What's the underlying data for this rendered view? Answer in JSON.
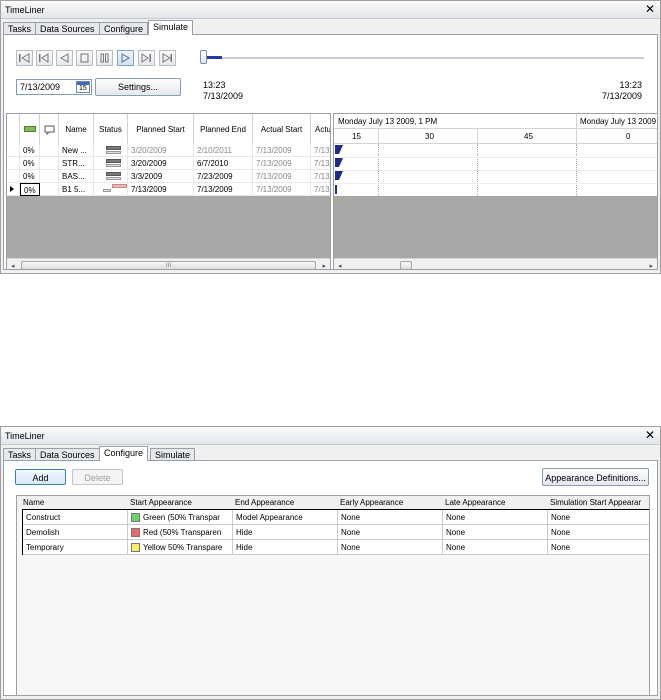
{
  "top": {
    "window_title": "TimeLiner",
    "tabs": [
      "Tasks",
      "Data Sources",
      "Configure",
      "Simulate"
    ],
    "date_input": "7/13/2009",
    "calendar_day": "15",
    "settings_label": "Settings...",
    "time_left": "13:23",
    "date_left": "7/13/2009",
    "time_right": "13:23",
    "date_right": "7/13/2009",
    "slider_position_fraction": 0.0,
    "columns": [
      "Name",
      "Status",
      "Planned Start",
      "Planned End",
      "Actual Start",
      "Actu"
    ],
    "rows": [
      {
        "pct": "0%",
        "name": "New ...",
        "ps": "3/20/2009",
        "pe": "2/10/2011",
        "as": "7/13/2009",
        "ae": "7/13/",
        "dim": true
      },
      {
        "pct": "0%",
        "name": "STR...",
        "ps": "3/20/2009",
        "pe": "6/7/2010",
        "as": "7/13/2009",
        "ae": "7/13/",
        "dim": false
      },
      {
        "pct": "0%",
        "name": "BAS...",
        "ps": "3/3/2009",
        "pe": "7/23/2009",
        "as": "7/13/2009",
        "ae": "7/13/",
        "dim": false
      },
      {
        "pct": "0%",
        "name": "B1 5...",
        "ps": "7/13/2009",
        "pe": "7/13/2009",
        "as": "7/13/2009",
        "ae": "7/13/",
        "dim": false
      }
    ],
    "gantt_header_1": "Monday July 13 2009, 1 PM",
    "gantt_header_2": "Monday July 13 2009",
    "gantt_ticks": [
      "15",
      "30",
      "45",
      "0"
    ],
    "hscroll_grip": "III"
  },
  "bottom": {
    "window_title": "TimeLiner",
    "tabs": [
      "Tasks",
      "Data Sources",
      "Configure",
      "Simulate"
    ],
    "add_label": "Add",
    "delete_label": "Delete",
    "appearance_defs_label": "Appearance Definitions...",
    "columns": [
      "Name",
      "Start Appearance",
      "End Appearance",
      "Early Appearance",
      "Late Appearance",
      "Simulation Start Appearar"
    ],
    "rows": [
      {
        "name": "Construct",
        "start": "Green (50% Transpar",
        "start_color": "#6ad36a",
        "end": "Model Appearance",
        "early": "None",
        "late": "None",
        "sim": "None"
      },
      {
        "name": "Demolish",
        "start": "Red (50% Transparen",
        "start_color": "#e86a6a",
        "end": "Hide",
        "early": "None",
        "late": "None",
        "sim": "None"
      },
      {
        "name": "Temporary",
        "start": "Yellow 50% Transpare",
        "start_color": "#f3ef6a",
        "end": "Hide",
        "early": "None",
        "late": "None",
        "sim": "None"
      }
    ]
  },
  "colors": {
    "accent": "#1f3fa0",
    "gantt_bar": "#1f2a8a",
    "grey_area": "#a8a8a8"
  }
}
